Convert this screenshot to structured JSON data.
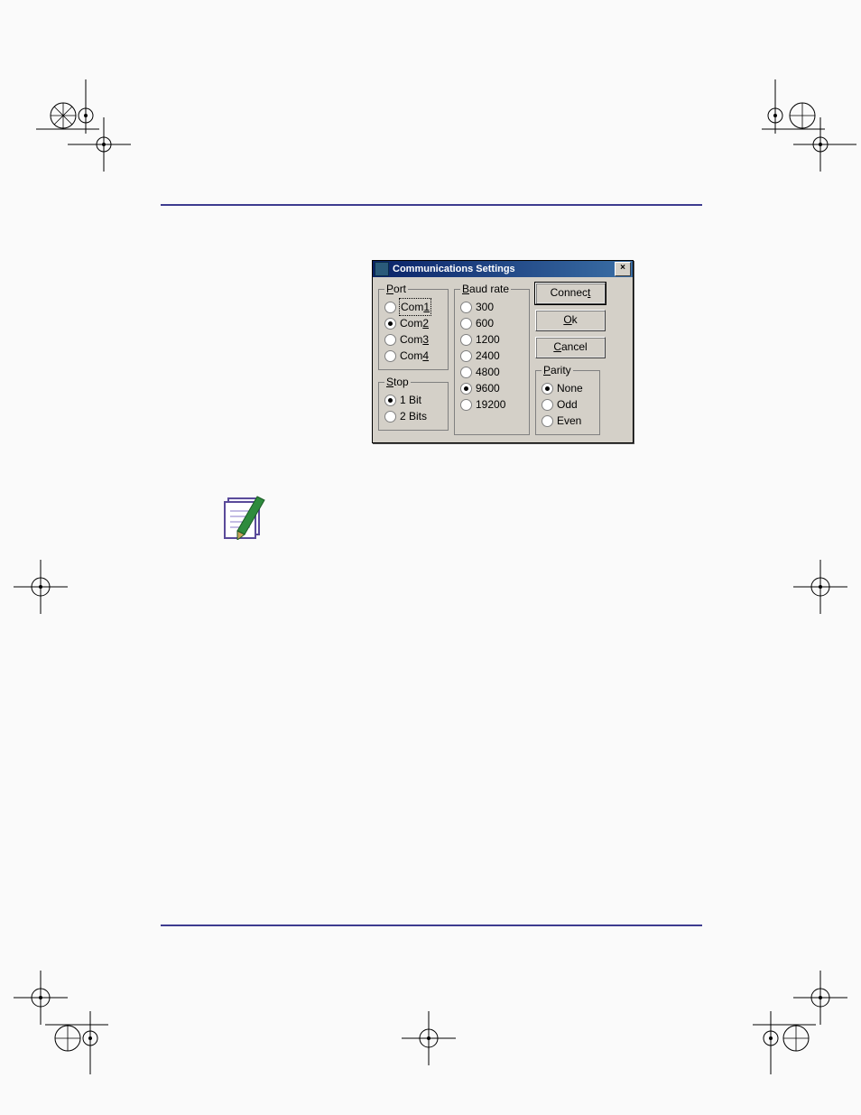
{
  "dialog": {
    "title": "Communications Settings",
    "close_glyph": "×",
    "groups": {
      "port": {
        "legend": "Port",
        "legend_u_index": 0,
        "options": [
          {
            "label": "Com1",
            "u_index": 3,
            "selected": false,
            "focused": true
          },
          {
            "label": "Com2",
            "u_index": 3,
            "selected": true,
            "focused": false
          },
          {
            "label": "Com3",
            "u_index": 3,
            "selected": false,
            "focused": false
          },
          {
            "label": "Com4",
            "u_index": 3,
            "selected": false,
            "focused": false
          }
        ]
      },
      "stop": {
        "legend": "Stop",
        "legend_u_index": 0,
        "options": [
          {
            "label": "1 Bit",
            "selected": true
          },
          {
            "label": "2 Bits",
            "selected": false
          }
        ]
      },
      "baud": {
        "legend": "Baud rate",
        "legend_u_index": 0,
        "options": [
          {
            "label": "300",
            "selected": false
          },
          {
            "label": "600",
            "selected": false
          },
          {
            "label": "1200",
            "selected": false
          },
          {
            "label": "2400",
            "selected": false
          },
          {
            "label": "4800",
            "selected": false
          },
          {
            "label": "9600",
            "selected": true
          },
          {
            "label": "19200",
            "selected": false
          }
        ]
      },
      "parity": {
        "legend": "Parity",
        "legend_u_index": 0,
        "options": [
          {
            "label": "None",
            "selected": true
          },
          {
            "label": "Odd",
            "selected": false
          },
          {
            "label": "Even",
            "selected": false
          }
        ]
      }
    },
    "buttons": {
      "connect": {
        "label": "Connect",
        "u_index": 6,
        "default": true
      },
      "ok": {
        "label": "Ok",
        "u_index": 0,
        "default": false
      },
      "cancel": {
        "label": "Cancel",
        "u_index": 0,
        "default": false
      }
    }
  }
}
